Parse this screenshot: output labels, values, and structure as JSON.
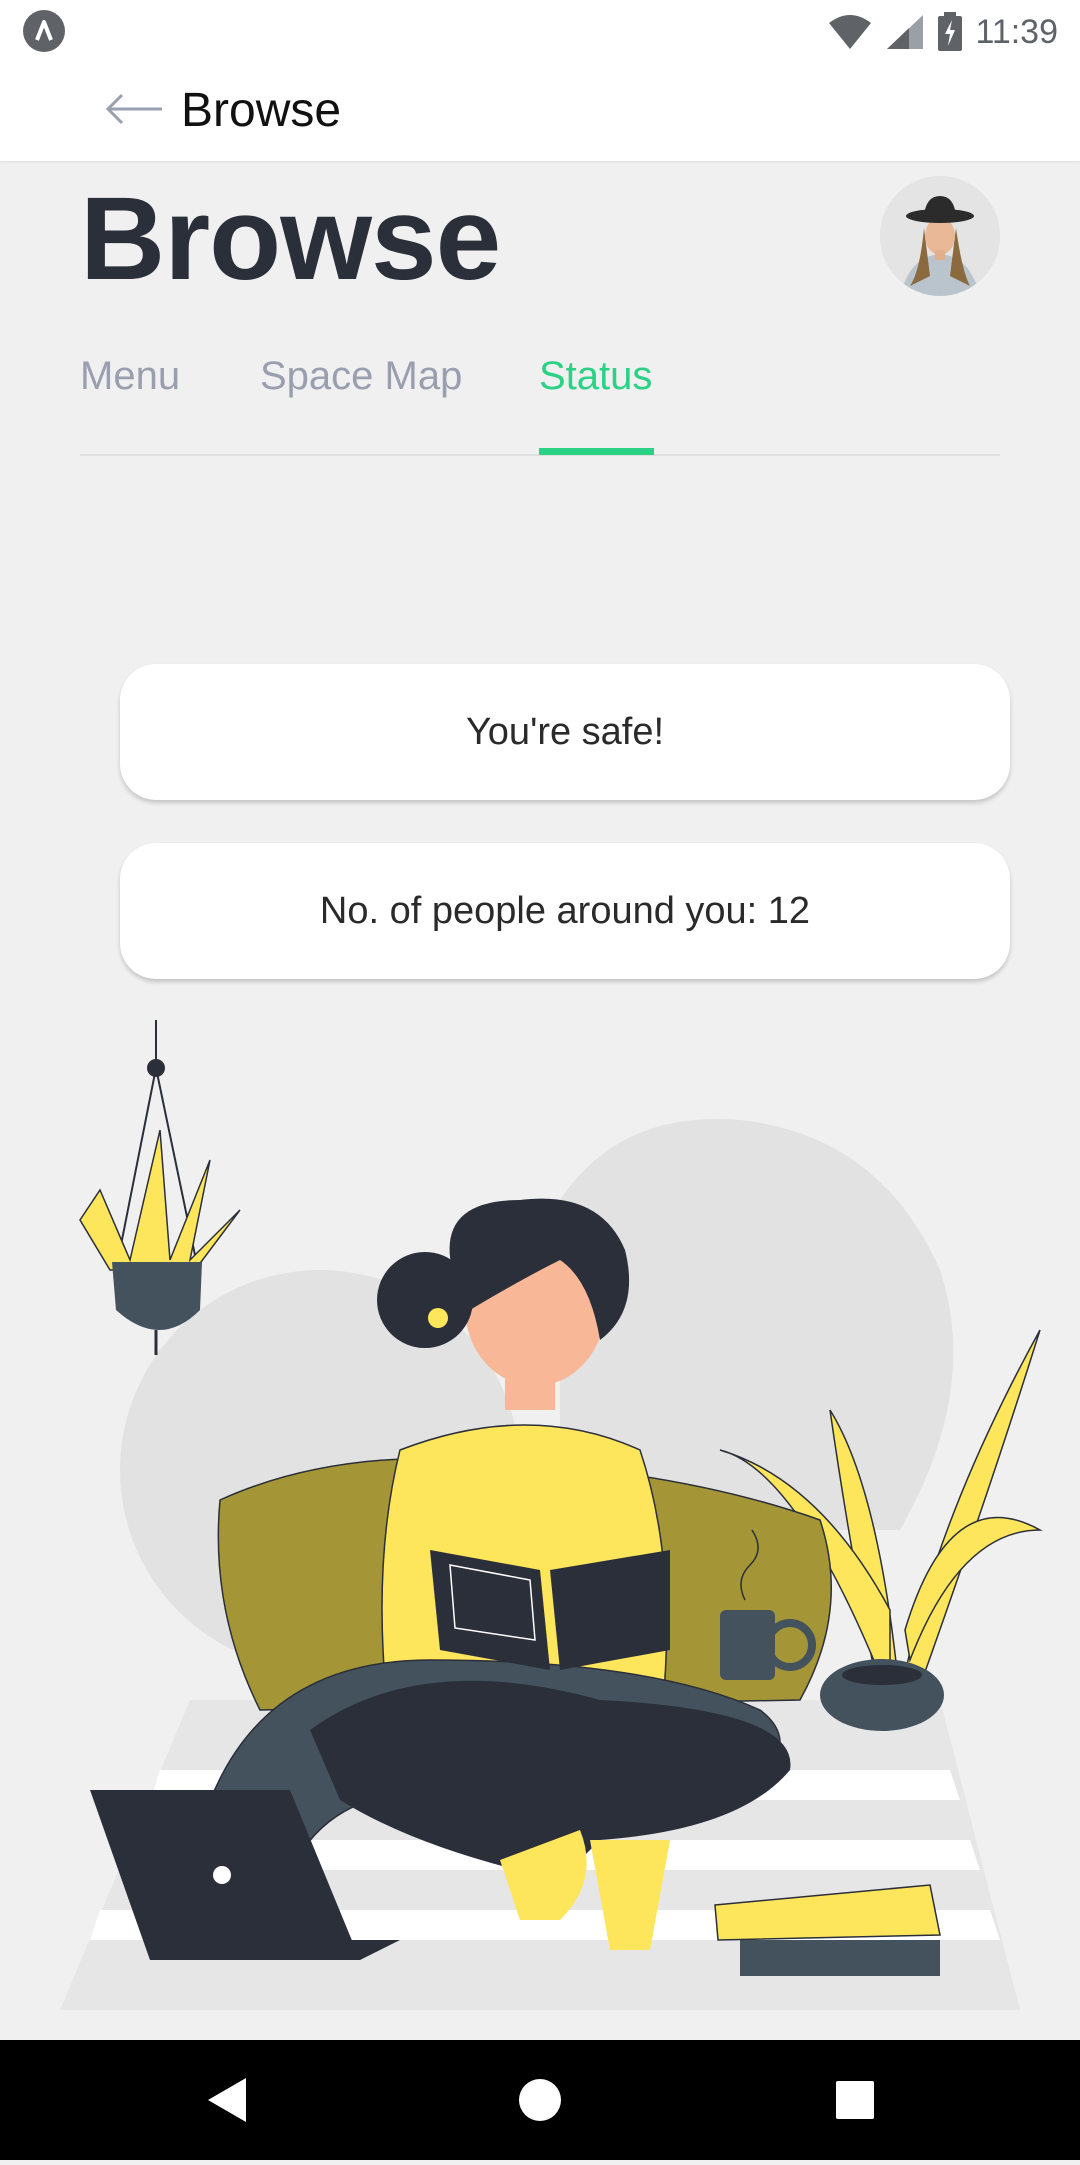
{
  "status_bar": {
    "time": "11:39",
    "icons": [
      "app-notification-icon",
      "wifi-icon",
      "signal-icon",
      "battery-charging-icon"
    ]
  },
  "app_bar": {
    "title": "Browse",
    "back_icon": "arrow-left-icon"
  },
  "header": {
    "title": "Browse",
    "avatar": "user-avatar"
  },
  "tabs": [
    {
      "label": "Menu",
      "active": false
    },
    {
      "label": "Space Map",
      "active": false
    },
    {
      "label": "Status",
      "active": true
    }
  ],
  "cards": {
    "safe_message": "You're safe!",
    "people_count": "No. of people around you: 12"
  },
  "illustration": "woman-reading-book-illustration",
  "nav_bar": {
    "icons": [
      "back-triangle-icon",
      "home-circle-icon",
      "recents-square-icon"
    ]
  },
  "colors": {
    "accent": "#2bd184",
    "title": "#2b2f3a",
    "tab_inactive": "#9a9fb0",
    "background": "#f0f0f0",
    "illustration_yellow": "#fde65b"
  }
}
